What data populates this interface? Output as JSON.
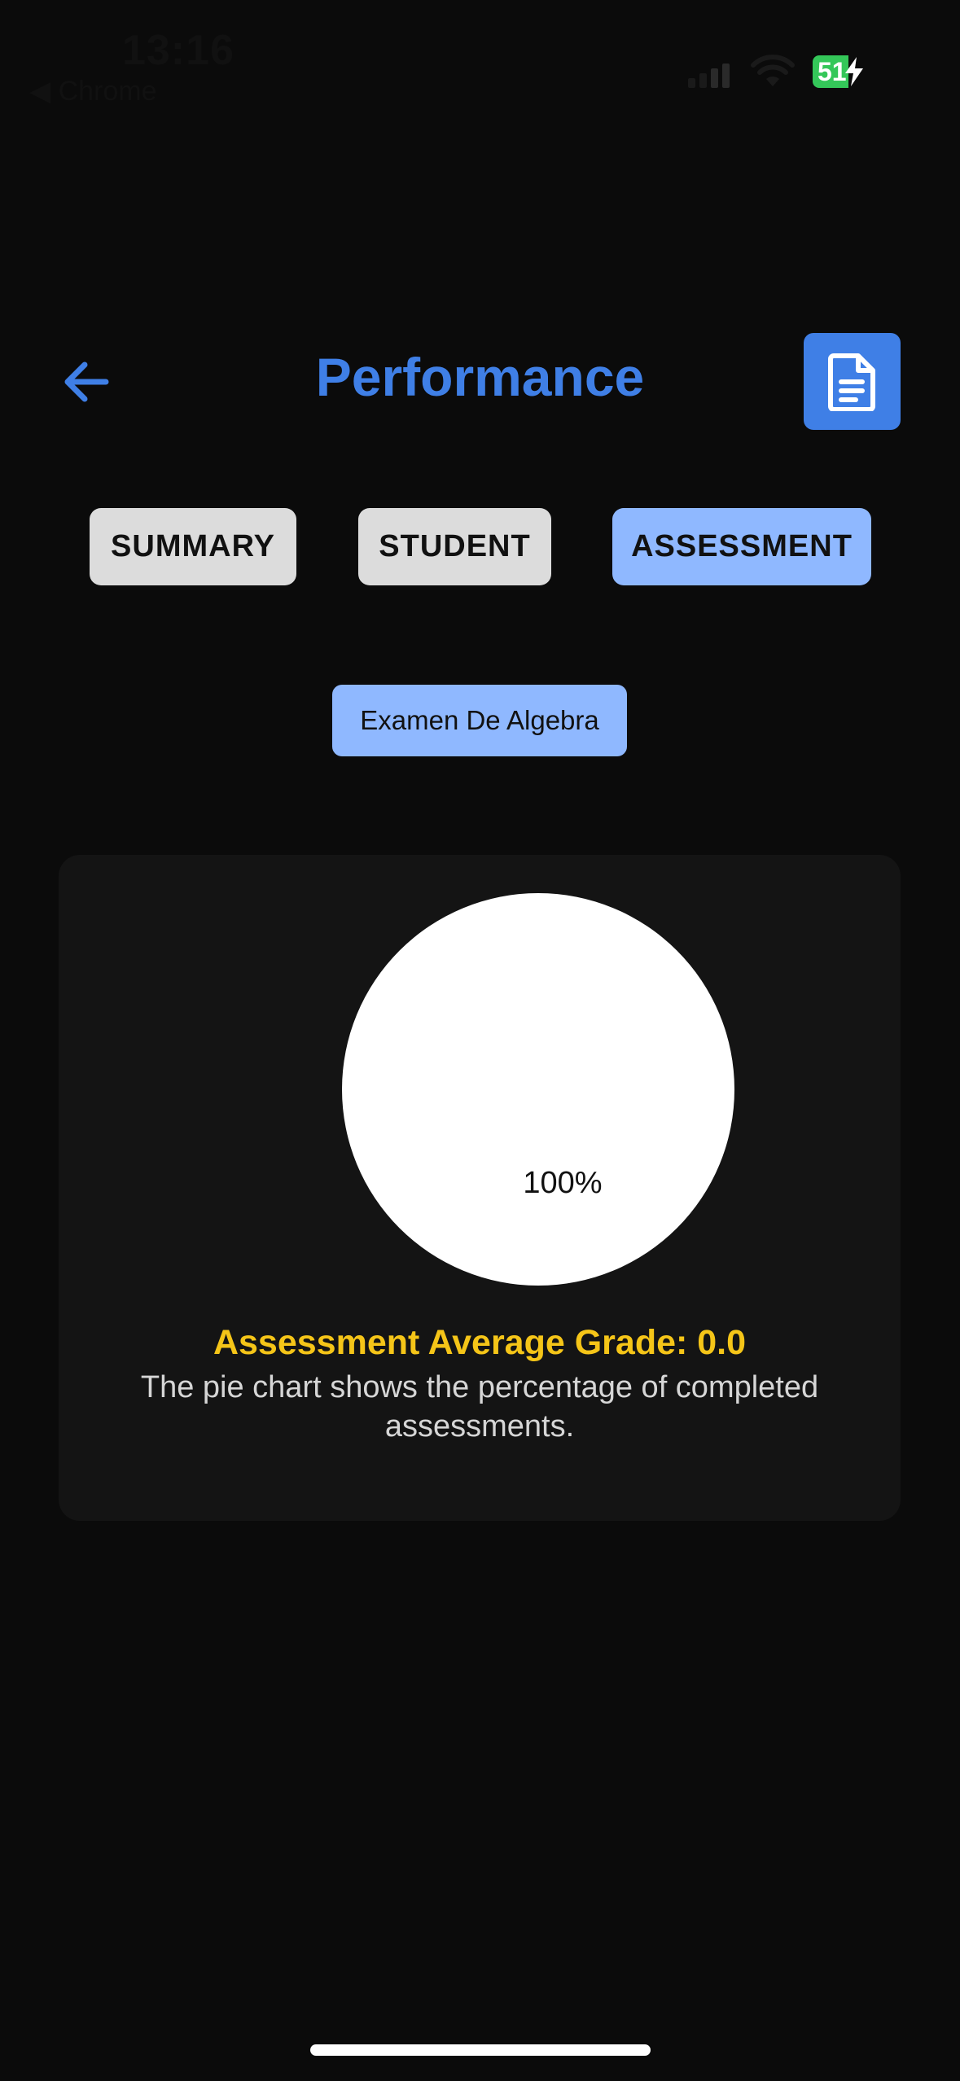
{
  "status_bar": {
    "time": "13:16",
    "back_app": "◀ Chrome",
    "battery_level": "51"
  },
  "header": {
    "title": "Performance",
    "back_icon": "arrow-left-icon",
    "report_icon": "document-icon"
  },
  "tabs": [
    {
      "label": "SUMMARY",
      "active": false
    },
    {
      "label": "STUDENT",
      "active": false
    },
    {
      "label": "ASSESSMENT",
      "active": true
    }
  ],
  "assessment_selector": {
    "selected": "Examen De Algebra"
  },
  "card": {
    "average_grade": "Assessment Average Grade: 0.0",
    "description": "The pie chart shows the percentage of completed assessments."
  },
  "chart_data": {
    "type": "pie",
    "slices": [
      {
        "value": 100,
        "label": "100%",
        "color": "#ffffff"
      }
    ]
  },
  "colors": {
    "accent": "#3f7fe6",
    "tab_active": "#8fb8ff",
    "tab_inactive": "#dcdcdc",
    "grade_text": "#f5c518",
    "background": "#0b0b0b",
    "card": "#141414"
  }
}
